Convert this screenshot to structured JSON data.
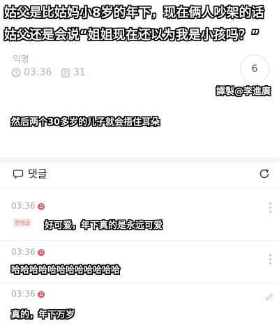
{
  "subtitles": {
    "top_line1": "姑父是比姑妈小8岁的年下，现在俩人吵架的话",
    "top_line2": "姑父还是会说“姐姐现在还以为我是小孩吗？”",
    "middle": "然后两个30多岁的儿子就会捂住耳朵"
  },
  "post": {
    "author": "익명",
    "time": "03:36",
    "views": "31",
    "comment_count": "6",
    "watermark": "譯製@李進廣"
  },
  "comments_header": {
    "title": "댓글"
  },
  "comments": [
    {
      "time": "03:36",
      "tag": "헌영글",
      "subtitle": "好可爱，年下真的是永远可爱"
    },
    {
      "time": "03:36",
      "subtitle": "哈哈哈哈哈哈哈哈哈哈哈哈"
    },
    {
      "time": "03:36",
      "subtitle": "真的，年下万岁"
    }
  ],
  "colors": {
    "accent_red": "#e0555c",
    "meta_gray": "#b3b3b3"
  },
  "icons": [
    "clock-icon",
    "views-icon",
    "chat-bubble-icon",
    "refresh-icon",
    "more-icon",
    "write-icon"
  ]
}
